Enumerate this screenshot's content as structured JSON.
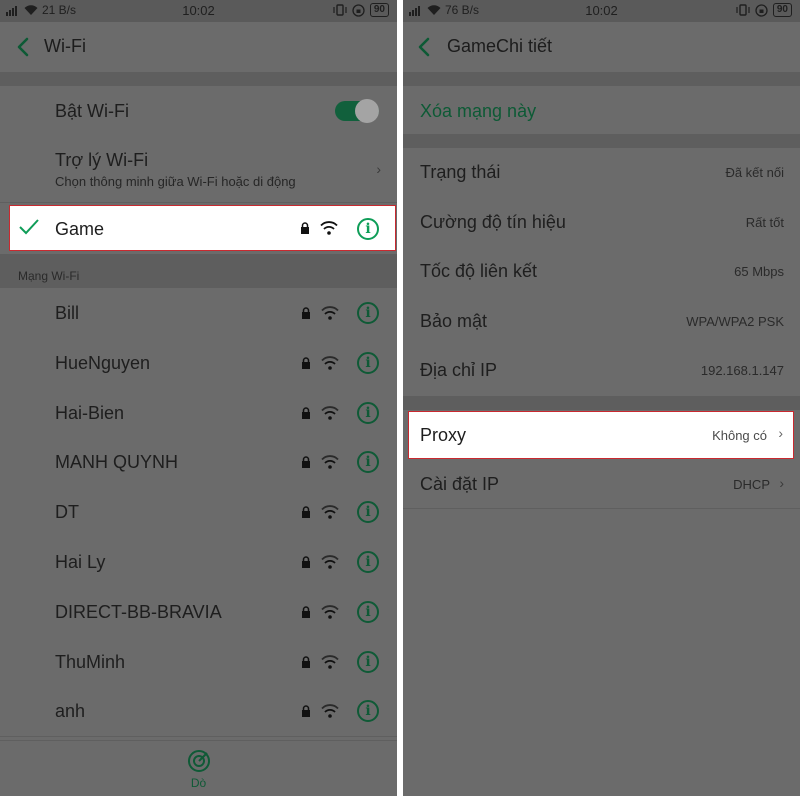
{
  "left": {
    "status": {
      "traffic": "21 B/s",
      "time": "10:02",
      "battery": "90"
    },
    "header": {
      "title": "Wi-Fi"
    },
    "wifi_toggle": {
      "label": "Bật Wi-Fi",
      "on": true
    },
    "assistant": {
      "label": "Trợ lý Wi-Fi",
      "subtitle": "Chọn thông minh giữa Wi-Fi hoặc di động"
    },
    "connected": {
      "name": "Game"
    },
    "section_label": "Mạng Wi-Fi",
    "networks": [
      {
        "name": "Bill"
      },
      {
        "name": "HueNguyen"
      },
      {
        "name": "Hai-Bien"
      },
      {
        "name": "MANH QUYNH"
      },
      {
        "name": "DT"
      },
      {
        "name": "Hai Ly"
      },
      {
        "name": "DIRECT-BB-BRAVIA"
      },
      {
        "name": "ThuMinh"
      },
      {
        "name": "anh"
      }
    ],
    "scan_label": "Dò"
  },
  "right": {
    "status": {
      "traffic": "76 B/s",
      "time": "10:02",
      "battery": "90"
    },
    "header": {
      "title": "GameChi tiết"
    },
    "forget_label": "Xóa mạng này",
    "details": [
      {
        "label": "Trạng thái",
        "value": "Đã kết nối"
      },
      {
        "label": "Cường độ tín hiệu",
        "value": "Rất tốt"
      },
      {
        "label": "Tốc độ liên kết",
        "value": "65 Mbps"
      },
      {
        "label": "Bảo mật",
        "value": "WPA/WPA2 PSK"
      },
      {
        "label": "Địa chỉ IP",
        "value": "192.168.1.147"
      }
    ],
    "proxy": {
      "label": "Proxy",
      "value": "Không có"
    },
    "ip_settings": {
      "label": "Cài đặt IP",
      "value": "DHCP"
    }
  },
  "colors": {
    "accent": "#0f9d58",
    "highlight_border": "#c9292f",
    "dim_overlay": "#6b6b6b"
  }
}
